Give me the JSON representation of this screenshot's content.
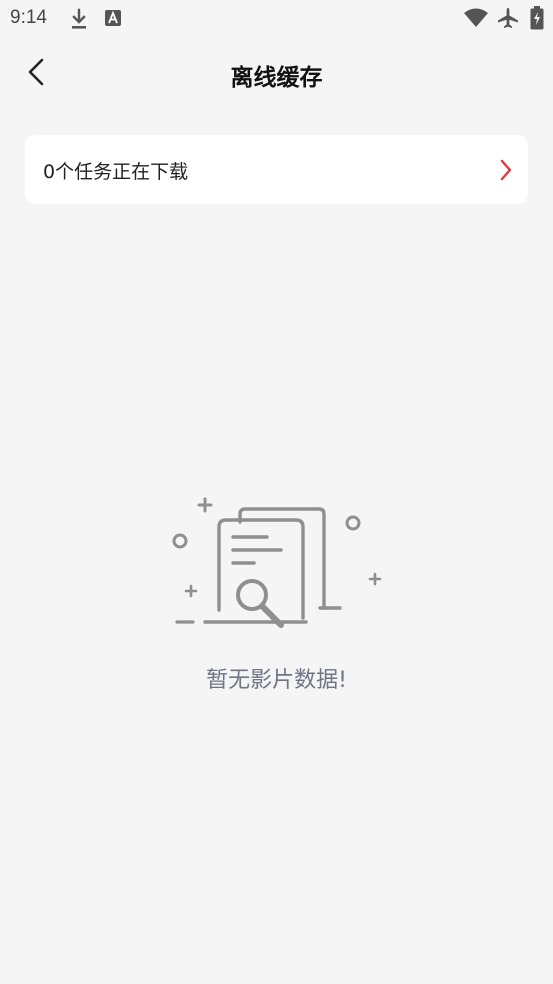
{
  "status_bar": {
    "time": "9:14",
    "icons": [
      "download-icon",
      "text-a-icon",
      "wifi-icon",
      "airplane-mode-icon",
      "battery-charging-icon"
    ]
  },
  "header": {
    "back_icon": "chevron-left-icon",
    "title": "离线缓存"
  },
  "download_tasks": {
    "label": "0个任务正在下载",
    "chevron_icon": "chevron-right-icon",
    "accent_color": "#e8343c"
  },
  "empty_state": {
    "illustration_icon": "document-search-icon",
    "message": "暂无影片数据!"
  }
}
